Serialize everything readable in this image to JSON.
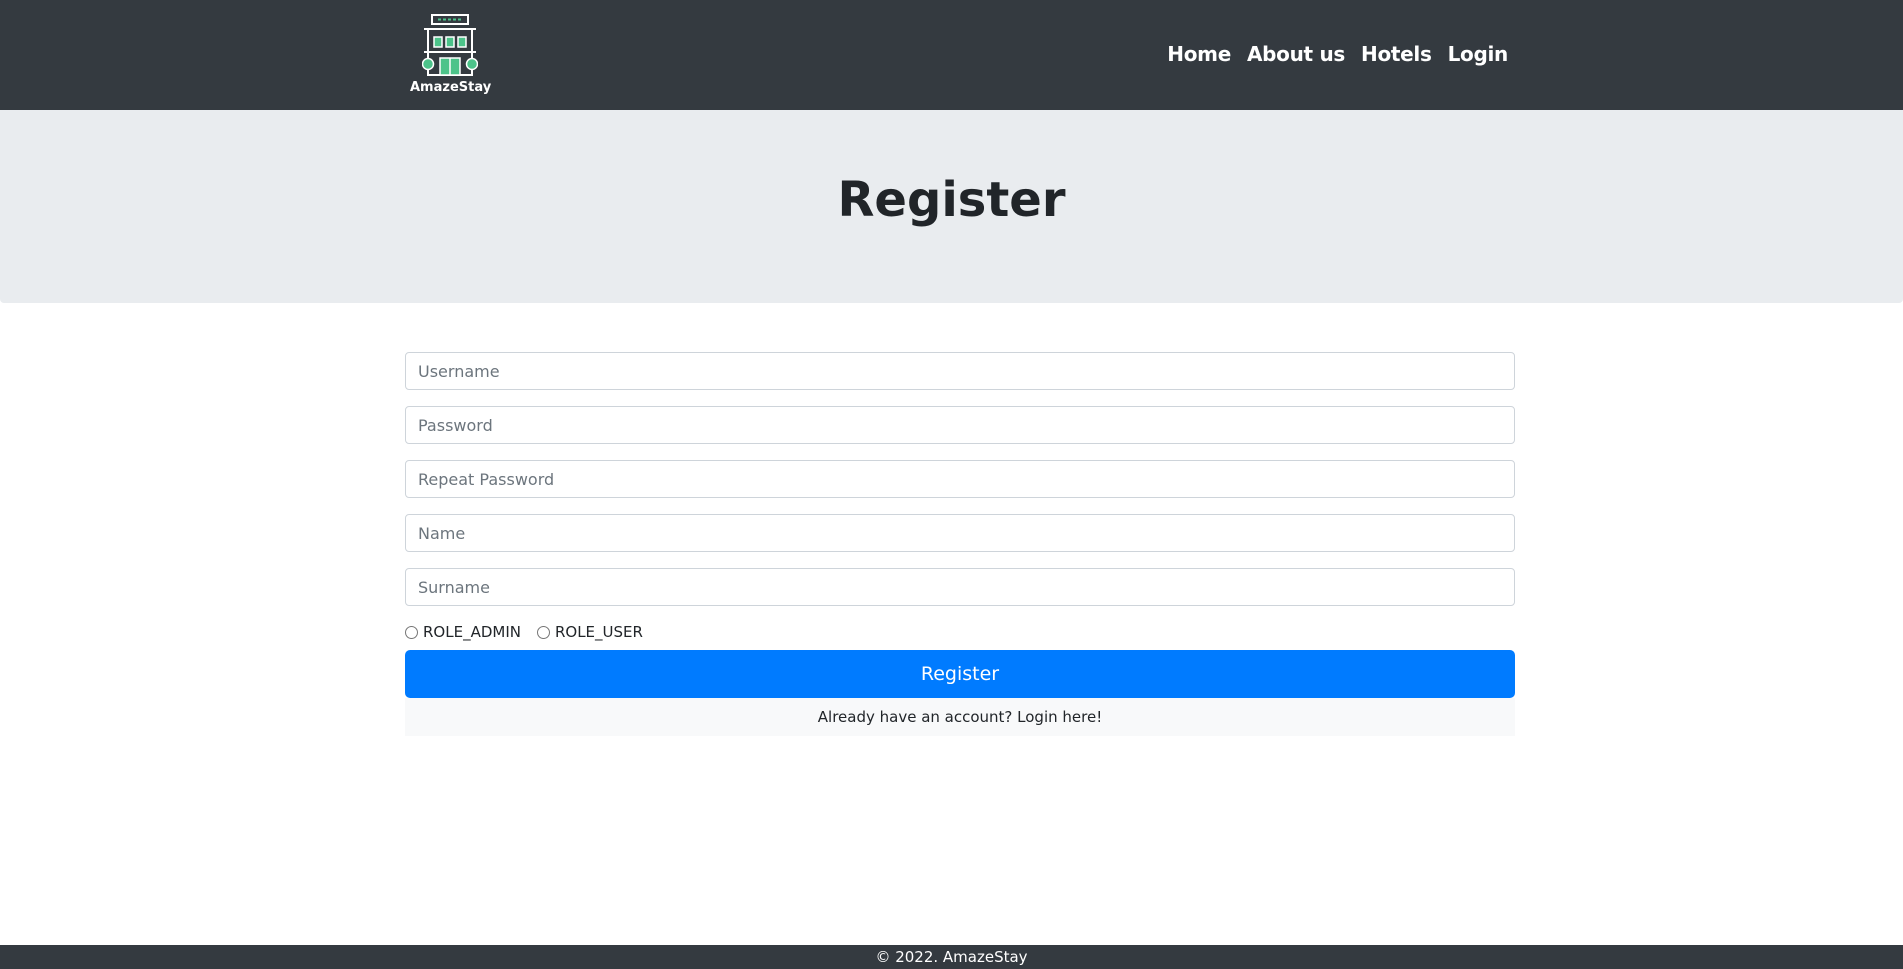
{
  "brand": {
    "name": "AmazeStay"
  },
  "nav": {
    "items": [
      {
        "label": "Home"
      },
      {
        "label": "About us"
      },
      {
        "label": "Hotels"
      },
      {
        "label": "Login"
      }
    ]
  },
  "page": {
    "title": "Register"
  },
  "form": {
    "username_placeholder": "Username",
    "password_placeholder": "Password",
    "repeat_password_placeholder": "Repeat Password",
    "name_placeholder": "Name",
    "surname_placeholder": "Surname",
    "roles": [
      {
        "label": "ROLE_ADMIN"
      },
      {
        "label": "ROLE_USER"
      }
    ],
    "submit_label": "Register",
    "login_link": "Already have an account? Login here!"
  },
  "footer": {
    "text": "© 2022. AmazeStay"
  },
  "colors": {
    "navbar": "#343a40",
    "jumbotron": "#e9ecef",
    "primary": "#007bff",
    "logo_accent": "#4cc38a"
  }
}
